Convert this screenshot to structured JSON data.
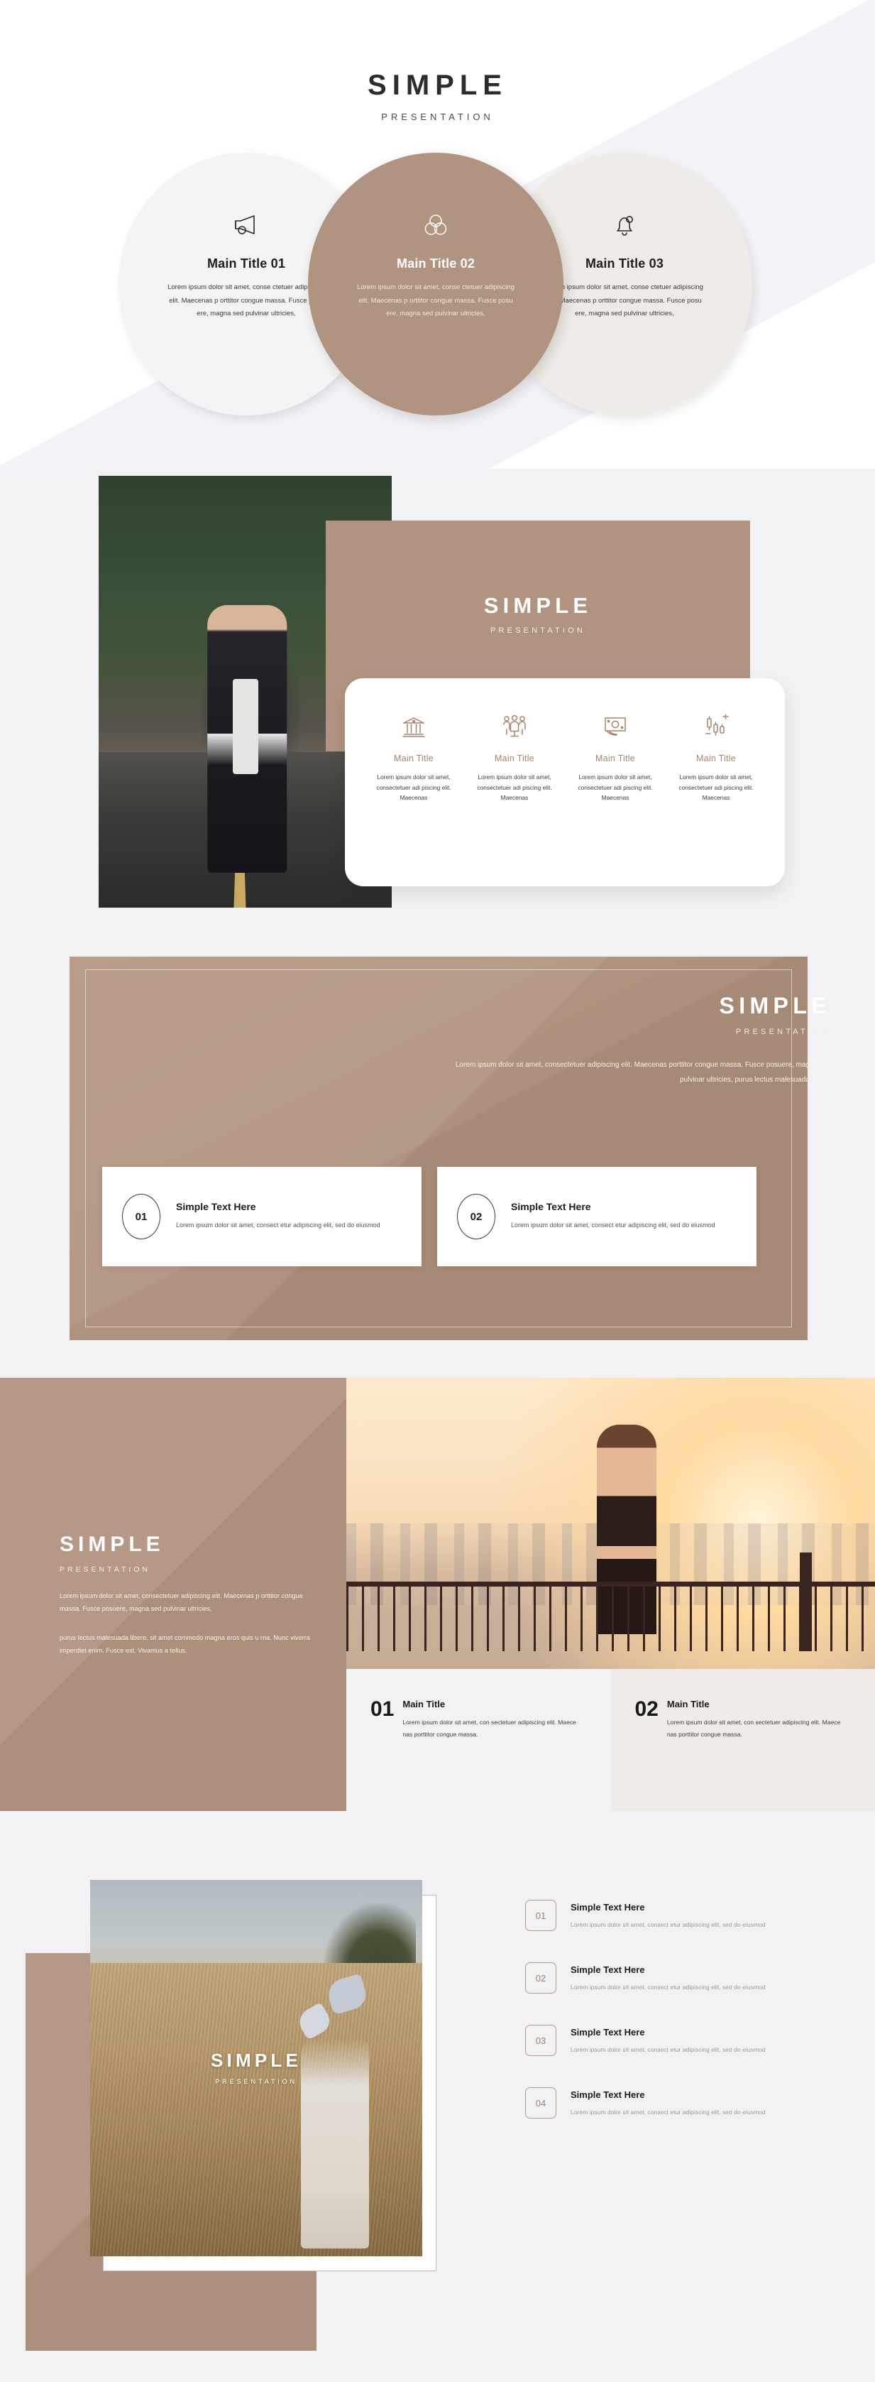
{
  "brand": {
    "title": "SIMPLE",
    "subtitle": "PRESENTATION"
  },
  "colors": {
    "brown": "#B1947F",
    "cream": "#EFEBE6",
    "light_gray": "#F2F2F4",
    "text_dark": "#1E1E1E",
    "accent_text": "#A9846C"
  },
  "section1": {
    "title": "SIMPLE",
    "subtitle": "PRESENTATION",
    "cards": [
      {
        "icon": "megaphone-icon",
        "title": "Main Title 01",
        "body": "Lorem ipsum dolor sit amet, conse ctetuer adipiscing elit. Maecenas p orttitor congue massa.  Fusce posu ere, magna sed pulvinar ultricies,"
      },
      {
        "icon": "venn-circles-icon",
        "title": "Main Title 02",
        "body": "Lorem ipsum dolor sit amet, conse ctetuer adipiscing elit. Maecenas p orttitor congue massa.  Fusce posu ere, magna sed pulvinar ultricies,"
      },
      {
        "icon": "bell-icon",
        "title": "Main Title 03",
        "body": "Lorem ipsum dolor sit amet, conse ctetuer adipiscing elit. Maecenas p orttitor congue massa.  Fusce posu ere, magna sed pulvinar ultricies,"
      }
    ]
  },
  "section2": {
    "photo_alt": "man-in-leather-jacket-on-road-photo",
    "title": "SIMPLE",
    "subtitle": "PRESENTATION",
    "features": [
      {
        "icon": "bank-icon",
        "title": "Main Title",
        "body": "Lorem ipsum dolor sit amet, consectetuer adi piscing elit. Maecenas"
      },
      {
        "icon": "group-people-icon",
        "title": "Main Title",
        "body": "Lorem ipsum dolor sit amet, consectetuer adi piscing elit. Maecenas"
      },
      {
        "icon": "money-bill-icon",
        "title": "Main Title",
        "body": "Lorem ipsum dolor sit amet, consectetuer adi piscing elit. Maecenas"
      },
      {
        "icon": "chart-plus-icon",
        "title": "Main Title",
        "body": "Lorem ipsum dolor sit amet, consectetuer adi piscing elit. Maecenas"
      }
    ]
  },
  "section3": {
    "title": "SIMPLE",
    "subtitle": "PRESENTATION",
    "paragraph": "Lorem ipsum dolor sit amet, consectetuer adipiscing elit. Maecenas porttitor congue massa. Fusce posuere, magna sed pulvinar ultricies, purus lectus malesuada libero,",
    "cards": [
      {
        "number": "01",
        "title": "Simple Text Here",
        "body": "Lorem ipsum dolor sit amet, consect etur adipiscing  elit, sed do eiusmod"
      },
      {
        "number": "02",
        "title": "Simple Text Here",
        "body": "Lorem ipsum dolor sit amet, consect etur adipiscing  elit, sed do eiusmod"
      }
    ]
  },
  "section4": {
    "title": "SIMPLE",
    "subtitle": "PRESENTATION",
    "paragraph1": "Lorem ipsum dolor sit amet, consectetuer  adipiscing  elit. Maecenas p orttitor congue massa. Fusce posuere, magna sed pulvinar ultricies,",
    "paragraph2": "purus lectus malesuada  libero, sit amet commodo magna eros quis u rna. Nunc viverra  imperdiet  enim. Fusce est. Vivamus a tellus.",
    "photo_alt": "woman-on-balcony-at-sunset-photo",
    "items": [
      {
        "number": "01",
        "title": "Main Title",
        "body": "Lorem ipsum dolor sit amet, con sectetuer adipiscing  elit. Maece nas porttitor congue massa."
      },
      {
        "number": "02",
        "title": "Main Title",
        "body": "Lorem ipsum dolor sit amet, con sectetuer adipiscing  elit. Maece nas porttitor congue massa."
      }
    ]
  },
  "section5": {
    "photo_alt": "person-in-wheat-field-photo",
    "photo_title": "SIMPLE",
    "photo_subtitle": "PRESENTATION",
    "items": [
      {
        "number": "01",
        "title": "Simple Text Here",
        "body": "Lorem ipsum dolor sit amet, consect etur adipiscing  elit, sed do eiusmod"
      },
      {
        "number": "02",
        "title": "Simple Text Here",
        "body": "Lorem ipsum dolor sit amet, consect etur adipiscing  elit, sed do eiusmod"
      },
      {
        "number": "03",
        "title": "Simple Text Here",
        "body": "Lorem ipsum dolor sit amet, consect etur adipiscing  elit, sed do eiusmod"
      },
      {
        "number": "04",
        "title": "Simple Text Here",
        "body": "Lorem ipsum dolor sit amet, consect etur adipiscing  elit, sed do eiusmod"
      }
    ]
  }
}
